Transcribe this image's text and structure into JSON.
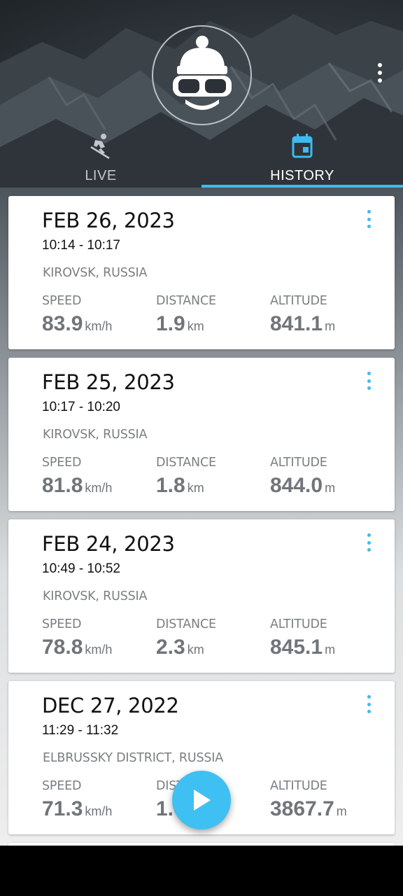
{
  "header": {
    "logo_icon": "skier-goggles-beanie-icon",
    "menu_icon": "more-vert-icon"
  },
  "tabs": [
    {
      "label": "LIVE",
      "icon": "skier-icon",
      "active": false
    },
    {
      "label": "HISTORY",
      "icon": "calendar-icon",
      "active": true
    }
  ],
  "accent_color": "#3cbcf0",
  "stat_labels": {
    "speed": "SPEED",
    "distance": "DISTANCE",
    "altitude": "ALTITUDE"
  },
  "units": {
    "speed": "km/h",
    "distance": "km",
    "altitude": "m"
  },
  "sessions": [
    {
      "date": "FEB 26, 2023",
      "time": "10:14 - 10:17",
      "location": "KIROVSK, RUSSIA",
      "speed": "83.9",
      "distance": "1.9",
      "altitude": "841.1"
    },
    {
      "date": "FEB 25, 2023",
      "time": "10:17 - 10:20",
      "location": "KIROVSK, RUSSIA",
      "speed": "81.8",
      "distance": "1.8",
      "altitude": "844.0"
    },
    {
      "date": "FEB 24, 2023",
      "time": "10:49 - 10:52",
      "location": "KIROVSK, RUSSIA",
      "speed": "78.8",
      "distance": "2.3",
      "altitude": "845.1"
    },
    {
      "date": "DEC 27, 2022",
      "time": "11:29 - 11:32",
      "location": "ELBRUSSKY DISTRICT, RUSSIA",
      "speed": "71.3",
      "distance": "1.6",
      "altitude": "3867.7"
    }
  ],
  "fab": {
    "icon": "play-icon"
  }
}
